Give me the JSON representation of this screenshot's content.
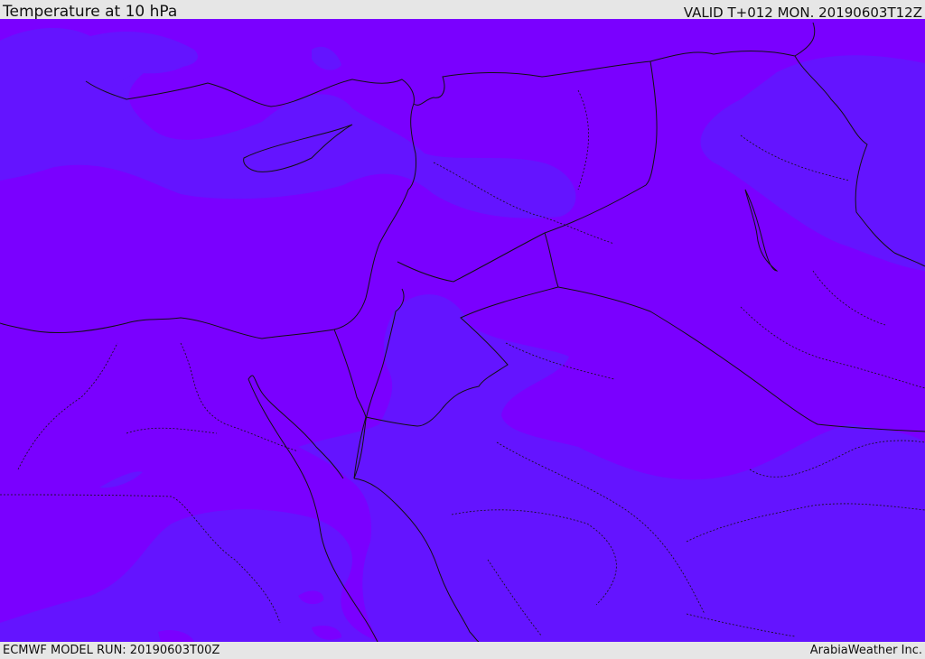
{
  "header": {
    "title": "Temperature at 10 hPa",
    "valid_time": "VALID T+012 MON. 20190603T12Z"
  },
  "footer": {
    "model_run": "ECMWF MODEL RUN: 20190603T00Z",
    "credit": "ArabiaWeather Inc."
  },
  "colors": {
    "warm_field": "#7a00ff",
    "cool_field": "#6414ff",
    "border": "#111111"
  }
}
